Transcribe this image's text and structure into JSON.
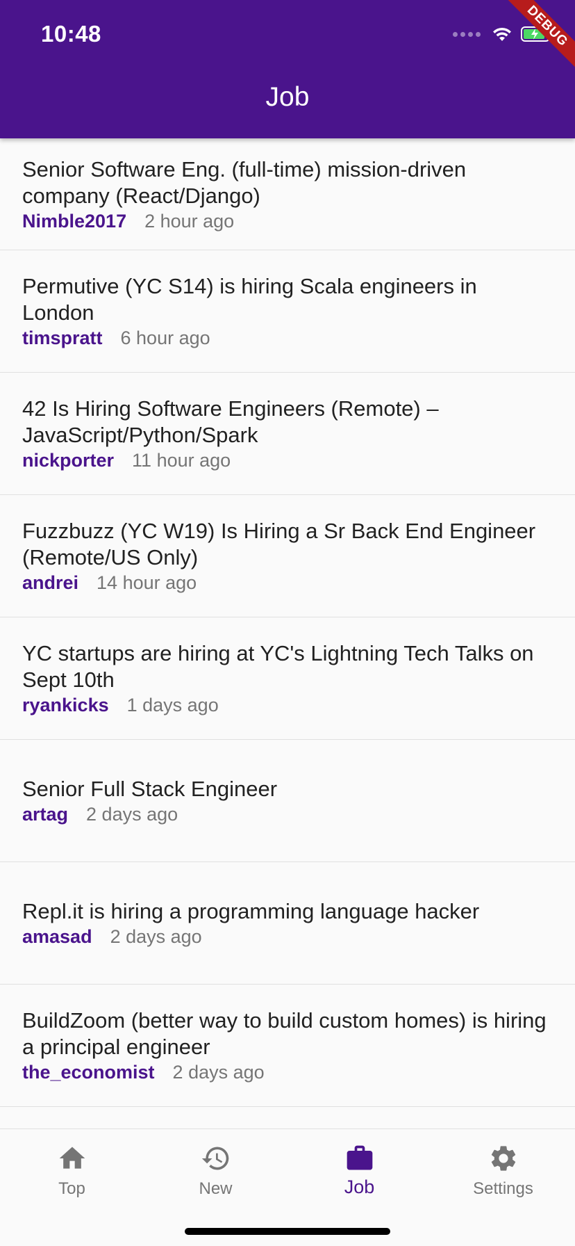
{
  "status_bar": {
    "time": "10:48"
  },
  "debug_banner": "DEBUG",
  "app_bar": {
    "title": "Job"
  },
  "jobs": [
    {
      "title": "Senior Software Eng. (full-time) mission-driven company (React/Django)",
      "author": "Nimble2017",
      "time": "2 hour ago"
    },
    {
      "title": "Permutive (YC S14) is hiring Scala engineers in London",
      "author": "timspratt",
      "time": "6 hour ago"
    },
    {
      "title": "42 Is Hiring Software Engineers (Remote) – JavaScript/Python/Spark",
      "author": "nickporter",
      "time": "11 hour ago"
    },
    {
      "title": "Fuzzbuzz (YC W19) Is Hiring a Sr Back End Engineer (Remote/US Only)",
      "author": "andrei",
      "time": "14 hour ago"
    },
    {
      "title": "YC startups are hiring at YC's Lightning Tech Talks on Sept 10th",
      "author": "ryankicks",
      "time": "1 days ago"
    },
    {
      "title": "Senior Full Stack Engineer",
      "author": "artag",
      "time": "2 days ago"
    },
    {
      "title": "Repl.it is hiring a programming language hacker",
      "author": "amasad",
      "time": "2 days ago"
    },
    {
      "title": "BuildZoom (better way to build custom homes) is hiring a principal engineer",
      "author": "the_economist",
      "time": "2 days ago"
    }
  ],
  "bottom_nav": {
    "tabs": [
      {
        "label": "Top",
        "icon": "home-icon"
      },
      {
        "label": "New",
        "icon": "history-icon"
      },
      {
        "label": "Job",
        "icon": "work-icon",
        "active": true
      },
      {
        "label": "Settings",
        "icon": "settings-icon"
      }
    ]
  },
  "colors": {
    "primary": "#4a148c",
    "inactive": "#757575",
    "background": "#fafafa"
  }
}
